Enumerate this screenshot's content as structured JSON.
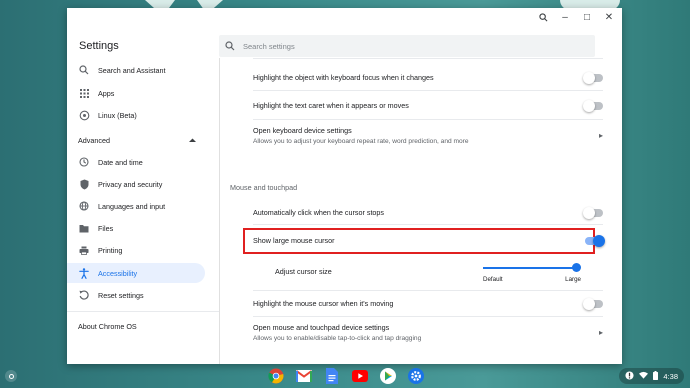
{
  "window": {
    "app_title": "Settings",
    "controls": {
      "zoom": "zoom-icon",
      "minimize": "–",
      "maximize": "□",
      "close": "✕"
    }
  },
  "search": {
    "placeholder": "Search settings"
  },
  "sidebar": {
    "items": [
      {
        "label": "Search and Assistant",
        "icon": "search-icon"
      },
      {
        "label": "Apps",
        "icon": "apps-grid-icon"
      },
      {
        "label": "Linux (Beta)",
        "icon": "linux-icon"
      }
    ],
    "advanced": {
      "label": "Advanced",
      "icon": "chevron-up-icon"
    },
    "advanced_items": [
      {
        "label": "Date and time",
        "icon": "clock-icon"
      },
      {
        "label": "Privacy and security",
        "icon": "shield-icon"
      },
      {
        "label": "Languages and input",
        "icon": "globe-icon"
      },
      {
        "label": "Files",
        "icon": "folder-icon"
      },
      {
        "label": "Printing",
        "icon": "printer-icon"
      },
      {
        "label": "Accessibility",
        "icon": "accessibility-icon",
        "active": true
      },
      {
        "label": "Reset settings",
        "icon": "reset-icon"
      }
    ],
    "about": "About Chrome OS"
  },
  "content": {
    "rows_top": [
      {
        "label": "Highlight the object with keyboard focus when it changes",
        "toggle": false
      },
      {
        "label": "Highlight the text caret when it appears or moves",
        "toggle": false
      }
    ],
    "keyboard_settings": {
      "label": "Open keyboard device settings",
      "sub": "Allows you to adjust your keyboard repeat rate, word prediction, and more"
    },
    "mouse_section": "Mouse and touchpad",
    "auto_click": {
      "label": "Automatically click when the cursor stops",
      "toggle": false
    },
    "large_cursor": {
      "label": "Show large mouse cursor",
      "toggle": true
    },
    "cursor_size": {
      "label": "Adjust cursor size",
      "min_label": "Default",
      "max_label": "Large",
      "value": 1.0
    },
    "highlight_cursor": {
      "label": "Highlight the mouse cursor when it's moving",
      "toggle": false
    },
    "mouse_settings": {
      "label": "Open mouse and touchpad device settings",
      "sub": "Allows you to enable/disable tap-to-click and tap dragging"
    }
  },
  "shelf": {
    "apps": [
      "chrome-icon",
      "gmail-icon",
      "docs-icon",
      "youtube-icon",
      "play-store-icon",
      "settings-icon"
    ],
    "time": "4:38",
    "colors": {
      "highlight_border": "#e02020",
      "accent": "#1a73e8"
    }
  }
}
